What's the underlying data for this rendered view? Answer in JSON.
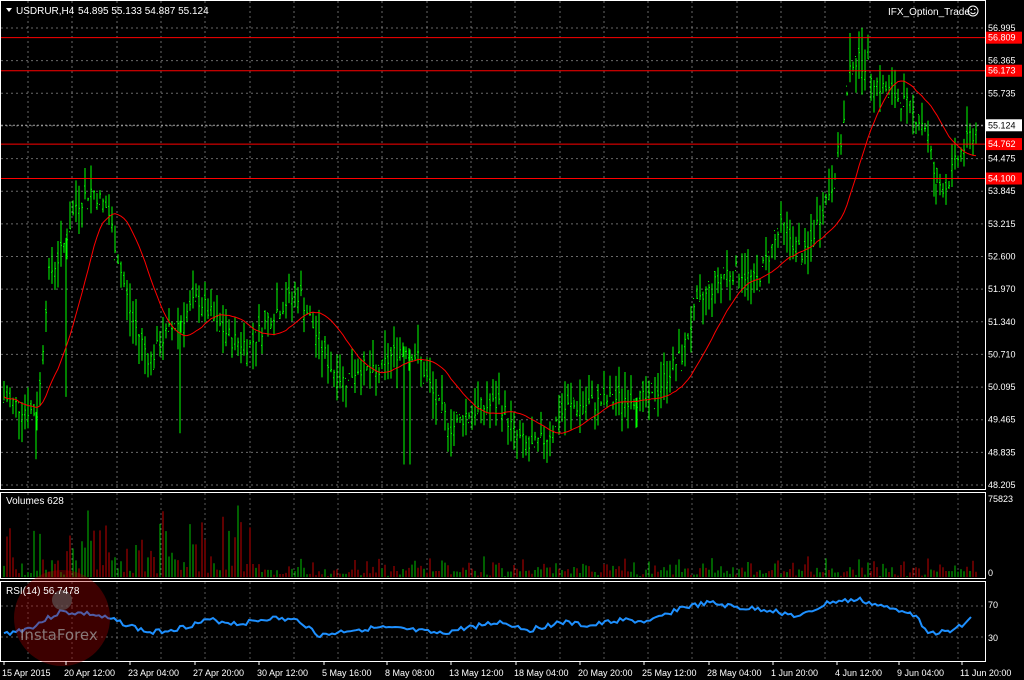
{
  "header": {
    "symbol": "USDRUR,H4",
    "ohlc": "54.895 55.133 54.887 55.124",
    "expert": "IFX_Option_Trade",
    "expert_icon": "smiley-icon"
  },
  "price_axis": {
    "labels": [
      "56.995",
      "56.365",
      "55.735",
      "55.124",
      "54.475",
      "53.845",
      "53.215",
      "52.600",
      "51.970",
      "51.340",
      "50.710",
      "50.095",
      "49.465",
      "48.835",
      "48.205"
    ],
    "current_price": "55.124"
  },
  "levels": [
    {
      "label": "56.809",
      "price": 56.809
    },
    {
      "label": "56.173",
      "price": 56.173
    },
    {
      "label": "54.762",
      "price": 54.762
    },
    {
      "label": "54.100",
      "price": 54.1
    }
  ],
  "volumes": {
    "title": "Volumes 628",
    "axis_labels": [
      "75823",
      "0"
    ]
  },
  "rsi": {
    "title": "RSI(14) 56.7478",
    "axis_labels": [
      "70",
      "30"
    ]
  },
  "time_axis": {
    "labels": [
      "15 Apr 2015",
      "20 Apr 12:00",
      "23 Apr 04:00",
      "27 Apr 20:00",
      "30 Apr 12:00",
      "5 May 16:00",
      "8 May 08:00",
      "13 May 12:00",
      "18 May 04:00",
      "20 May 20:00",
      "25 May 12:00",
      "28 May 04:00",
      "1 Jun 20:00",
      "4 Jun 12:00",
      "9 Jun 04:00",
      "11 Jun 20:00"
    ]
  },
  "watermark": {
    "text": "InstaForex"
  },
  "colors": {
    "background": "#000000",
    "bull": "#00ff00",
    "ma": "#ff0000",
    "level": "#ff0000",
    "rsi": "#1e90ff",
    "grid": "#c0c0c0",
    "vol_green": "#00c000",
    "vol_red": "#c00000"
  }
}
